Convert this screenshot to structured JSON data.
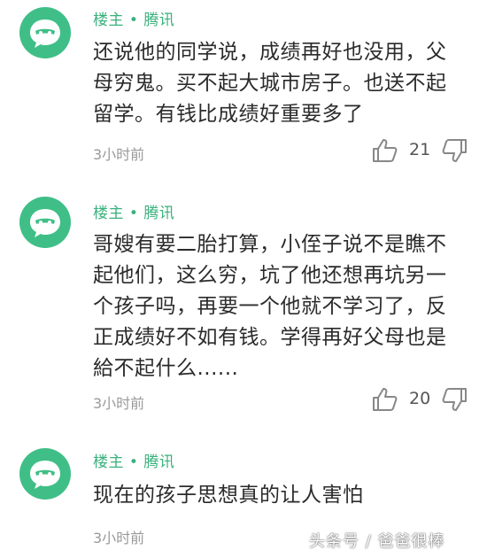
{
  "comments": [
    {
      "author": "楼主 • 腾讯",
      "lines": [
        "还说他的同学说，成绩再好也没用，父",
        "母穷鬼。买不起大城市房子。也送不起",
        "留学。有钱比成绩好重要多了"
      ],
      "time": "3小时前",
      "likes": "21"
    },
    {
      "author": "楼主 • 腾讯",
      "lines": [
        "哥嫂有要二胎打算，小侄子说不是瞧不",
        "起他们，这么穷，坑了他还想再坑另一",
        "个孩子吗，再要一个他就不学习了，反",
        "正成绩好不如有钱。学得再好父母也是",
        "給不起什么......"
      ],
      "time": "3小时前",
      "likes": "20"
    },
    {
      "author": "楼主 • 腾讯",
      "lines": [
        "现在的孩子思想真的让人害怕"
      ],
      "time": "3小时前",
      "likes": ""
    }
  ],
  "watermark": "头条号 / 爸爸很棒",
  "colors": {
    "accent": "#39b17c",
    "avatar_bg": "#3fbf87"
  },
  "icons": [
    "avatar-icon",
    "thumbs-up-icon",
    "thumbs-down-icon"
  ]
}
